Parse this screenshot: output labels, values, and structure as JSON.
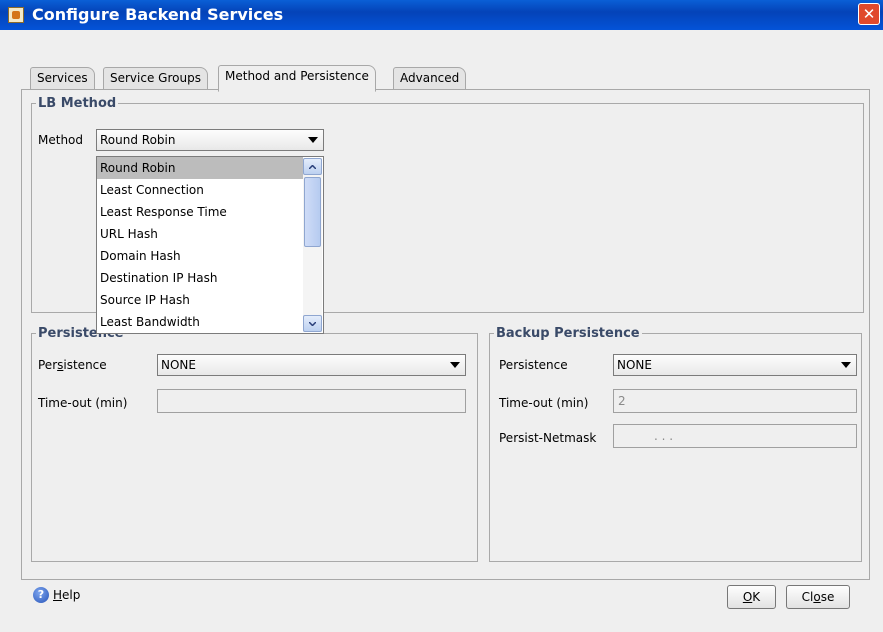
{
  "window": {
    "title": "Configure Backend Services",
    "close_glyph": "✕"
  },
  "tabs": [
    {
      "label": "Services",
      "active": false
    },
    {
      "label": "Service Groups",
      "active": false
    },
    {
      "label": "Method and Persistence",
      "active": true
    },
    {
      "label": "Advanced",
      "active": false
    }
  ],
  "lb_method": {
    "legend": "LB Method",
    "method_label": "Method",
    "method_value": "Round Robin",
    "options": [
      "Round Robin",
      "Least Connection",
      "Least Response Time",
      "URL Hash",
      "Domain Hash",
      "Destination IP Hash",
      "Source IP Hash",
      "Least Bandwidth"
    ],
    "selected_index": 0
  },
  "persistence": {
    "legend": "Persistence",
    "persistence_label_pre": "Per",
    "persistence_label_u": "s",
    "persistence_label_post": "istence",
    "persistence_value": "NONE",
    "timeout_label": "Time-out (min)",
    "timeout_value": ""
  },
  "backup_persistence": {
    "legend": "Backup Persistence",
    "persistence_label": "Persistence",
    "persistence_value": "NONE",
    "timeout_label": "Time-out (min)",
    "timeout_value": "2",
    "netmask_label": "Persist-Netmask",
    "netmask_value": ".      .      ."
  },
  "footer": {
    "help_label_u": "H",
    "help_label_rest": "elp",
    "ok_label_u": "O",
    "ok_label_rest": "K",
    "close_label_pre": "Cl",
    "close_label_u": "o",
    "close_label_post": "se"
  },
  "colors": {
    "titlebar": "#0453d8",
    "legend_text": "#3a4a68",
    "selected_item": "#bcbcbc"
  },
  "icons": {
    "app": "java-cup-icon",
    "close": "close-icon",
    "help": "help-icon"
  }
}
